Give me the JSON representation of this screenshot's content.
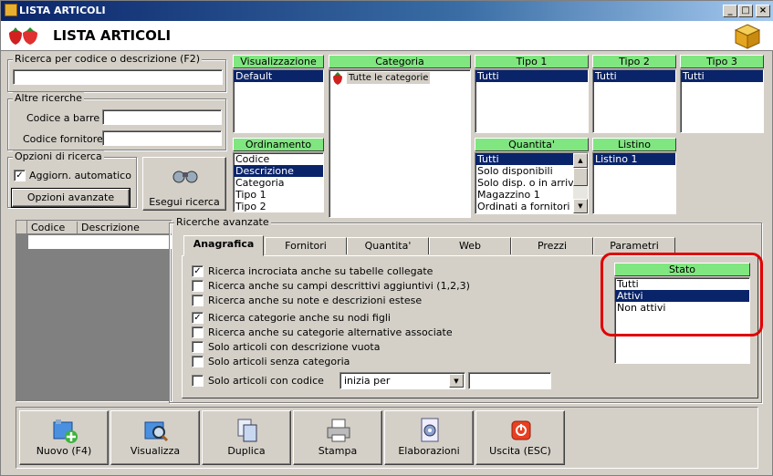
{
  "window": {
    "title": "LISTA ARTICOLI",
    "header": "LISTA ARTICOLI",
    "min": "_",
    "max": "□",
    "close": "×"
  },
  "search": {
    "legend": "Ricerca per codice o descrizione (F2)",
    "value": ""
  },
  "other": {
    "legend": "Altre ricerche",
    "barcode_label": "Codice a barre :",
    "supplier_label": "Codice fornitore :"
  },
  "options": {
    "legend": "Opzioni di ricerca",
    "auto_label": "Aggiorn. automatico",
    "auto_checked": true,
    "advanced_button": "Opzioni avanzate",
    "search_button": "Esegui ricerca"
  },
  "panels": {
    "visualizzazione": {
      "title": "Visualizzazione",
      "items": [
        "Default"
      ],
      "selected": 0
    },
    "categoria": {
      "title": "Categoria",
      "items": [
        "Tutte le categorie"
      ]
    },
    "tipo1": {
      "title": "Tipo 1",
      "items": [
        "Tutti"
      ]
    },
    "tipo2": {
      "title": "Tipo 2",
      "items": [
        "Tutti"
      ]
    },
    "tipo3": {
      "title": "Tipo 3",
      "items": [
        "Tutti"
      ]
    },
    "ordinamento": {
      "title": "Ordinamento",
      "items": [
        "Codice",
        "Descrizione",
        "Categoria",
        "Tipo 1",
        "Tipo 2"
      ],
      "selected": 1
    },
    "quantita": {
      "title": "Quantita'",
      "items": [
        "Tutti",
        "Solo disponibili",
        "Solo disp. o in arrivo",
        "Magazzino 1",
        "Ordinati a fornitori"
      ],
      "selected": 0
    },
    "listino": {
      "title": "Listino",
      "items": [
        "Listino 1"
      ],
      "selected": 0
    }
  },
  "grid": {
    "columns": [
      "Codice",
      "Descrizione"
    ]
  },
  "advanced": {
    "legend": "Ricerche avanzate",
    "tabs": [
      "Anagrafica",
      "Fornitori",
      "Quantita'",
      "Web",
      "Prezzi",
      "Parametri"
    ],
    "active_tab": 0,
    "checks": [
      {
        "label": "Ricerca incrociata anche su tabelle collegate",
        "checked": true
      },
      {
        "label": "Ricerca anche su campi descrittivi aggiuntivi (1,2,3)",
        "checked": false
      },
      {
        "label": "Ricerca anche su note e descrizioni estese",
        "checked": false
      },
      {
        "label": "Ricerca categorie anche su nodi figli",
        "checked": true
      },
      {
        "label": "Ricerca anche su categorie alternative associate",
        "checked": false
      },
      {
        "label": "Solo articoli con descrizione vuota",
        "checked": false
      },
      {
        "label": "Solo articoli senza categoria",
        "checked": false
      }
    ],
    "code_check": {
      "label": "Solo articoli con codice",
      "checked": false
    },
    "code_mode": "inizia per",
    "stato": {
      "title": "Stato",
      "items": [
        "Tutti",
        "Attivi",
        "Non attivi"
      ],
      "selected": 1
    },
    "highlight_color": "#e00000"
  },
  "toolbar": [
    "Nuovo (F4)",
    "Visualizza",
    "Duplica",
    "Stampa",
    "Elaborazioni",
    "Uscita (ESC)"
  ],
  "colors": {
    "header_green": "#80e680",
    "selection": "#0a246a"
  }
}
